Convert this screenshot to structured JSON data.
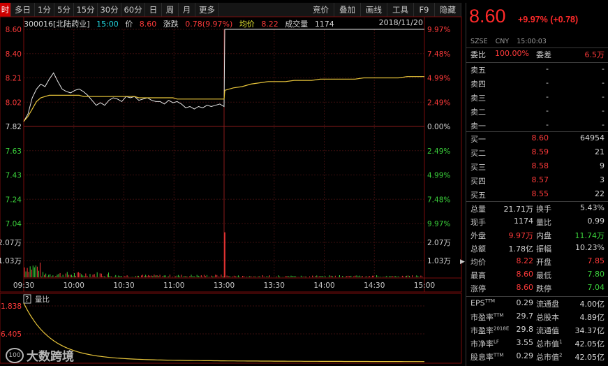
{
  "toolbar": {
    "items": [
      "时",
      "多日",
      "1分",
      "5分",
      "15分",
      "30分",
      "60分",
      "日",
      "周",
      "月",
      "更多"
    ],
    "right_items": [
      "竞价",
      "叠加",
      "画线",
      "工具",
      "F9",
      "隐藏"
    ]
  },
  "info": {
    "code_name": "300016[北陆药业]",
    "time": "15:00",
    "price_label": "价",
    "price": "8.60",
    "change_label": "涨跌",
    "change": "0.78(9.97%)",
    "avg_label": "均价",
    "avg": "8.22",
    "volume_label": "成交量",
    "volume": "1174",
    "date": "2018/11/20"
  },
  "chart_data": {
    "type": "line",
    "title": "",
    "y_price_ticks": [
      "8.60",
      "8.40",
      "8.21",
      "8.02",
      "7.82",
      "7.63",
      "7.43",
      "7.24",
      "7.04"
    ],
    "y_pct_ticks": [
      "9.97%",
      "7.48%",
      "4.99%",
      "2.49%",
      "0.00%",
      "2.49%",
      "4.99%",
      "7.48%",
      "9.97%"
    ],
    "prev_close": 7.82,
    "ylim": [
      7.04,
      8.6
    ],
    "vol_ticks": [
      "2.07万",
      "1.03万"
    ],
    "x_ticks": [
      "09:30",
      "10:00",
      "10:30",
      "11:00",
      "13:00",
      "13:30",
      "14:00",
      "14:30",
      "15:00"
    ],
    "series": [
      {
        "values": [
          7.86,
          7.92,
          8.05,
          8.12,
          8.16,
          8.14,
          8.2,
          8.25,
          8.18,
          8.12,
          8.1,
          8.09,
          8.11,
          8.12,
          8.1,
          8.07,
          8.03,
          7.99,
          8.01,
          7.99,
          8.03,
          8.05,
          8.04,
          8.02,
          8.06,
          8.05,
          8.06,
          8.03,
          8.04,
          8.05,
          8.03,
          8.02,
          8.02,
          8.0,
          8.03,
          8.01,
          8.02,
          8.0,
          7.97,
          7.98,
          7.96,
          7.98,
          7.97,
          7.99,
          7.98,
          7.99,
          8.0,
          7.98,
          8.6,
          8.6,
          8.6
        ]
      },
      {
        "values": [
          7.86,
          7.9,
          7.96,
          8.02,
          8.05,
          8.06,
          8.07,
          8.07,
          8.07,
          8.07,
          8.07,
          8.07,
          8.07,
          8.07,
          8.06,
          8.06,
          8.06,
          8.06,
          8.06,
          8.06,
          8.06,
          8.06,
          8.06,
          8.06,
          8.06,
          8.06,
          8.06,
          8.05,
          8.05,
          8.05,
          8.05,
          8.05,
          8.05,
          8.05,
          8.05,
          8.05,
          8.04,
          8.04,
          8.04,
          8.04,
          8.04,
          8.04,
          8.04,
          8.04,
          8.04,
          8.04,
          8.04,
          8.04,
          8.11,
          8.13,
          8.14,
          8.16,
          8.17,
          8.18,
          8.18,
          8.18,
          8.19,
          8.19,
          8.19,
          8.2,
          8.2,
          8.2,
          8.2,
          8.2,
          8.21,
          8.21,
          8.21,
          8.21,
          8.21,
          8.22,
          8.22,
          8.22
        ]
      }
    ],
    "volume_spike": 2.5,
    "vol_ratio_ticks": [
      "1.838",
      "6.405"
    ],
    "vol_ratio_label": "量比"
  },
  "panel": {
    "price": "8.60",
    "change": "+9.97% (+0.78)",
    "exchange": "SZSE",
    "currency": "CNY",
    "time": "15:00:03",
    "weibi_label": "委比",
    "weibi": "100.00%",
    "weicha_label": "委差",
    "weicha": "6.5万",
    "asks": [
      {
        "label": "卖五",
        "price": "-",
        "vol": "-"
      },
      {
        "label": "卖四",
        "price": "-",
        "vol": "-"
      },
      {
        "label": "卖三",
        "price": "-",
        "vol": "-"
      },
      {
        "label": "卖二",
        "price": "-",
        "vol": "-"
      },
      {
        "label": "卖一",
        "price": "-",
        "vol": "-"
      }
    ],
    "bids": [
      {
        "label": "买一",
        "price": "8.60",
        "vol": "64954"
      },
      {
        "label": "买二",
        "price": "8.59",
        "vol": "21"
      },
      {
        "label": "买三",
        "price": "8.58",
        "vol": "9"
      },
      {
        "label": "买四",
        "price": "8.57",
        "vol": "3"
      },
      {
        "label": "买五",
        "price": "8.55",
        "vol": "22"
      }
    ],
    "stats": [
      {
        "l1": "总量",
        "v1": "21.71万",
        "c1": "white",
        "l2": "换手",
        "v2": "5.43%",
        "c2": "white"
      },
      {
        "l1": "现手",
        "v1": "1174",
        "c1": "white",
        "l2": "量比",
        "v2": "0.99",
        "c2": "white"
      },
      {
        "l1": "外盘",
        "v1": "9.97万",
        "c1": "red",
        "l2": "内盘",
        "v2": "11.74万",
        "c2": "green"
      },
      {
        "l1": "总额",
        "v1": "1.78亿",
        "c1": "white",
        "l2": "振幅",
        "v2": "10.23%",
        "c2": "white"
      },
      {
        "l1": "均价",
        "v1": "8.22",
        "c1": "red",
        "l2": "开盘",
        "v2": "7.85",
        "c2": "red"
      },
      {
        "l1": "最高",
        "v1": "8.60",
        "c1": "red",
        "l2": "最低",
        "v2": "7.80",
        "c2": "green"
      },
      {
        "l1": "涨停",
        "v1": "8.60",
        "c1": "red",
        "l2": "跌停",
        "v2": "7.04",
        "c2": "green"
      }
    ],
    "fundamentals": [
      {
        "l1": "EPS",
        "s1": "TTM",
        "v1": "0.29",
        "l2": "流通盘",
        "s2": "",
        "v2": "4.00亿"
      },
      {
        "l1": "市盈率",
        "s1": "TTM",
        "v1": "29.7",
        "l2": "总股本",
        "s2": "",
        "v2": "4.89亿"
      },
      {
        "l1": "市盈率",
        "s1": "2018E",
        "v1": "29.8",
        "l2": "流通值",
        "s2": "",
        "v2": "34.37亿"
      },
      {
        "l1": "市净率",
        "s1": "LF",
        "v1": "3.55",
        "l2": "总市值",
        "s2": "1",
        "v2": "42.05亿"
      },
      {
        "l1": "股息率",
        "s1": "TTM",
        "v1": "0.29",
        "l2": "总市值",
        "s2": "2",
        "v2": "42.05亿"
      }
    ]
  },
  "logo": {
    "mark": "100",
    "text": "大数跨境"
  },
  "colors": {
    "up": "#ff3a3a",
    "down": "#3bd23b",
    "avg": "#e8c53a",
    "price_line": "#e8e8e8",
    "grid": "#3a0e0e"
  }
}
